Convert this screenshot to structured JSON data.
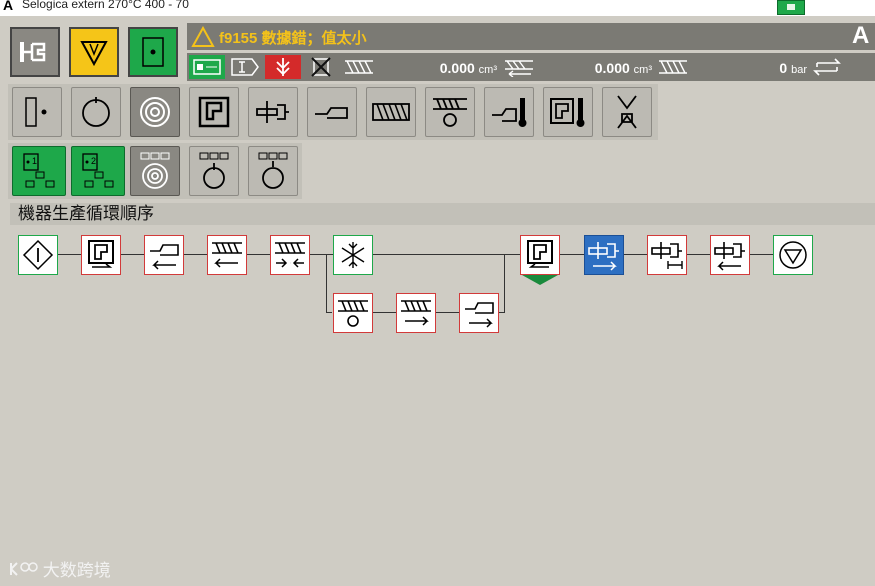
{
  "window": {
    "title": "Selogica extern  270°C  400 -  70"
  },
  "alarm": {
    "code_text": "f9155 數據錯；值太小",
    "icon": "warning-triangle-icon",
    "color": "#f4c21a"
  },
  "status": {
    "value1": "0.000",
    "unit1": "cm³",
    "value2": "0.000",
    "unit2": "cm³",
    "value3": "0",
    "unit3": "bar"
  },
  "section": {
    "title": "機器生產循環順序"
  },
  "watermark": {
    "text": "大数跨境"
  },
  "colors": {
    "accent_green": "#1ea84a",
    "accent_yellow": "#f5c518",
    "step_red": "#d23a3a",
    "step_blue": "#2d6fc2",
    "alarm_bg": "#7b7a74"
  }
}
